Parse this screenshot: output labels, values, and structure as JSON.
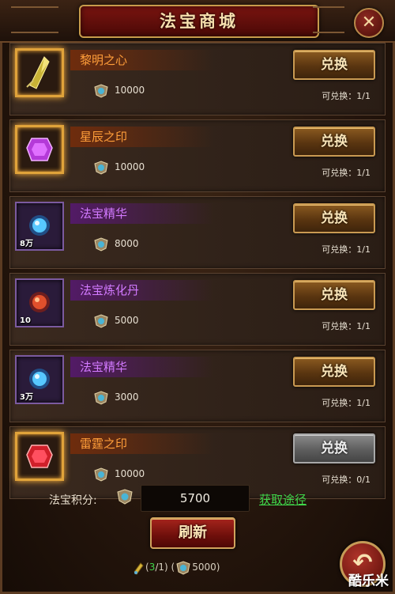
{
  "header": {
    "title": "法宝商城",
    "close_icon": "close-icon"
  },
  "items": [
    {
      "name": "黎明之心",
      "price": "10000",
      "exchange_label": "兑换",
      "limit": "可兑换：1/1",
      "qty": "",
      "icon": "yellow-crystal-icon",
      "enabled": true
    },
    {
      "name": "星辰之印",
      "price": "10000",
      "exchange_label": "兑换",
      "limit": "可兑换：1/1",
      "qty": "",
      "icon": "purple-gem-icon",
      "enabled": true
    },
    {
      "name": "法宝精华",
      "price": "8000",
      "exchange_label": "兑换",
      "limit": "可兑换：1/1",
      "qty": "8万",
      "icon": "blue-orb-icon",
      "enabled": true
    },
    {
      "name": "法宝炼化丹",
      "price": "5000",
      "exchange_label": "兑换",
      "limit": "可兑换：1/1",
      "qty": "10",
      "icon": "red-orb-icon",
      "enabled": true
    },
    {
      "name": "法宝精华",
      "price": "3000",
      "exchange_label": "兑换",
      "limit": "可兑换：1/1",
      "qty": "3万",
      "icon": "blue-orb-icon",
      "enabled": true
    },
    {
      "name": "雷霆之印",
      "price": "10000",
      "exchange_label": "兑换",
      "limit": "可兑换：0/1",
      "qty": "",
      "icon": "red-gem-icon",
      "enabled": false
    }
  ],
  "footer": {
    "points_label": "法宝积分:",
    "points_value": "5700",
    "get_link": "获取途径",
    "refresh_label": "刷新",
    "refresh_prefix": "(",
    "refresh_count": "3",
    "refresh_total": "/1)",
    "refresh_cost": "(",
    "refresh_cost_value": "5000)",
    "back_icon": "back-arrow-icon"
  },
  "watermark": "酷乐米",
  "colors": {
    "orange_name": "#ff9e3a",
    "violet_name": "#d27aff",
    "link_green": "#3fd64a",
    "gold_border": "#e0a33a"
  }
}
